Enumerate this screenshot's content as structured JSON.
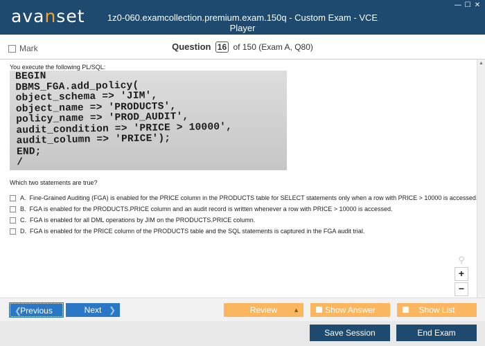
{
  "app": {
    "logo_pre": "ava",
    "logo_accent": "n",
    "logo_post": "set",
    "title": "1z0-060.examcollection.premium.exam.150q - Custom Exam - VCE Player",
    "win_buttons": [
      "—",
      "☐",
      "✕"
    ]
  },
  "question_bar": {
    "mark_label": "Mark",
    "question_label": "Question",
    "question_number": "16",
    "of_text": "of 150 (Exam A, Q80)"
  },
  "question": {
    "intro": "You execute the following PL/SQL:",
    "code": "BEGIN\nDBMS_FGA.add_policy(\nobject_schema => 'JIM',\nobject_name => 'PRODUCTS',\npolicy_name => 'PROD_AUDIT',\naudit_condition => 'PRICE > 10000',\naudit_column => 'PRICE');\nEND;\n/",
    "prompt": "Which two statements are true?",
    "options": [
      {
        "letter": "A.",
        "text": "Fine-Grained Auditing (FGA) is enabled for the PRICE column in the PRODUCTS table for SELECT statements only when a row with PRICE > 10000 is accessed."
      },
      {
        "letter": "B.",
        "text": "FGA is enabled for the PRODUCTS.PRICE column and an audit record is written whenever a row with PRICE > 10000 is accessed."
      },
      {
        "letter": "C.",
        "text": "FGA is enabled for all DML operations by JIM on the PRODUCTS.PRICE column."
      },
      {
        "letter": "D.",
        "text": "FGA is enabled for the PRICE column of the PRODUCTS table and the SQL statements is captured in the FGA audit trial."
      }
    ]
  },
  "zoom": {
    "in": "+",
    "out": "−"
  },
  "nav": {
    "previous": "Previous",
    "next": "Next",
    "review": "Review",
    "show_answer": "Show Answer",
    "show_list": "Show List"
  },
  "footer": {
    "save": "Save Session",
    "end": "End Exam"
  },
  "colors": {
    "titlebar": "#1d4a6e",
    "nav_blue": "#2a78c5",
    "nav_orange": "#fbb660",
    "logo_accent": "#f7a22b"
  }
}
